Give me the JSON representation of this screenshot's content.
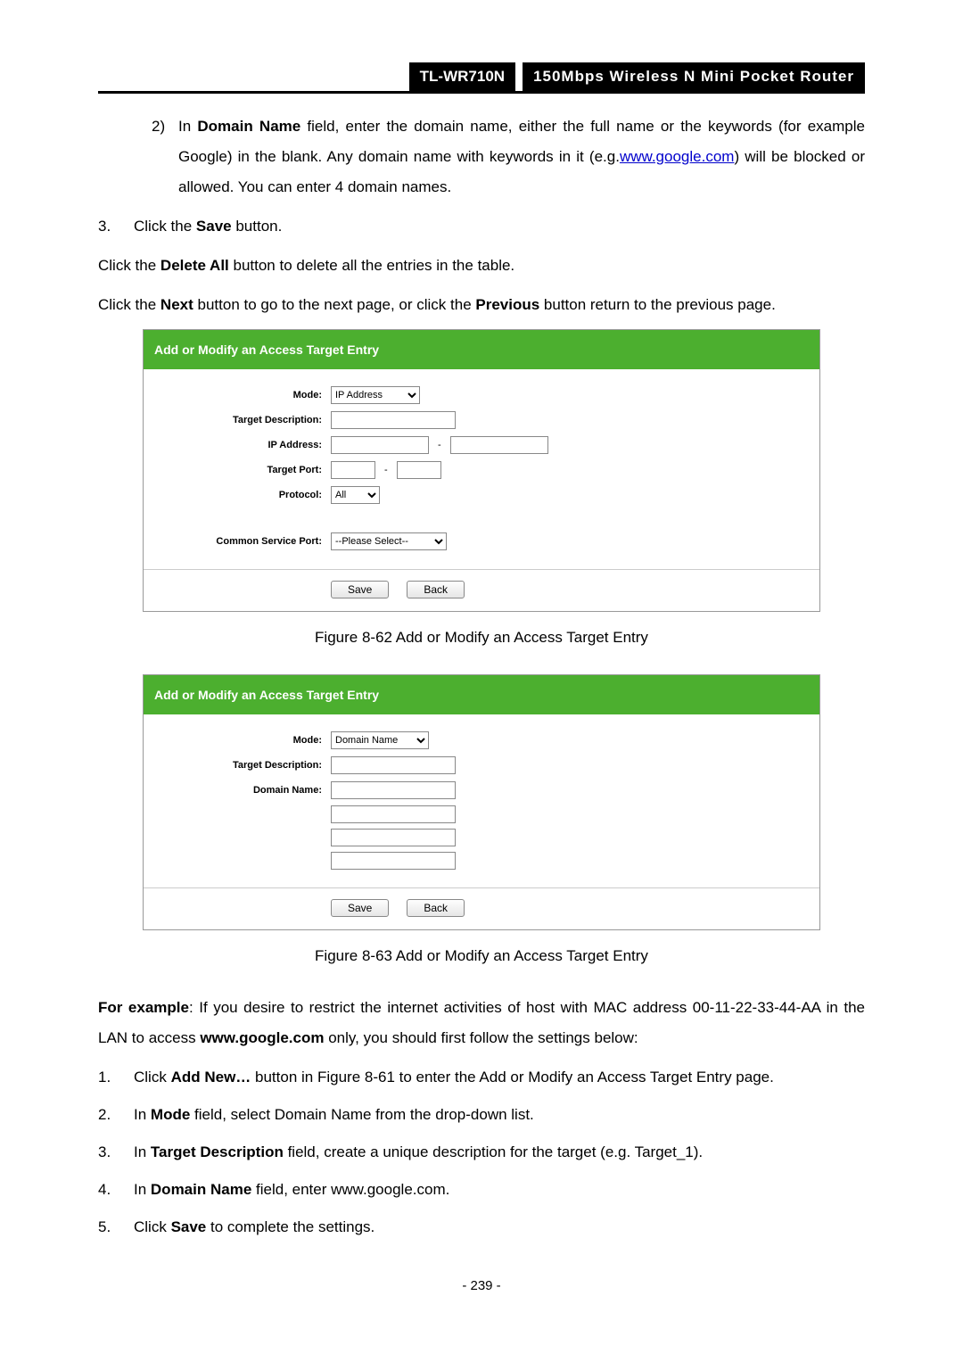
{
  "header": {
    "model": "TL-WR710N",
    "desc": "150Mbps Wireless N Mini Pocket Router"
  },
  "intro": {
    "item2_marker": "2)",
    "item2_prefix": "In ",
    "item2_bold": "Domain Name",
    "item2_rest_a": " field, enter the domain name, either the full name or the keywords (for example Google) in the blank. Any domain name with keywords in it (e.g.",
    "item2_link": "www.google.com",
    "item2_rest_b": ") will be blocked or allowed. You can enter 4 domain names.",
    "item3_marker": "3.",
    "item3_text_a": "Click the ",
    "item3_bold": "Save",
    "item3_text_b": " button.",
    "para_delete_a": "Click the ",
    "para_delete_bold": "Delete All",
    "para_delete_b": " button to delete all the entries in the table.",
    "para_nav_a": "Click the ",
    "para_nav_bold1": "Next",
    "para_nav_b": " button to go to the next page, or click the ",
    "para_nav_bold2": "Previous",
    "para_nav_c": " button return to the previous page."
  },
  "panel1": {
    "title": "Add or Modify an Access Target Entry",
    "labels": {
      "mode": "Mode:",
      "target_desc": "Target Description:",
      "ip": "IP Address:",
      "port": "Target Port:",
      "protocol": "Protocol:",
      "common": "Common Service Port:"
    },
    "values": {
      "mode": "IP Address",
      "protocol": "All",
      "common": "--Please Select--"
    },
    "buttons": {
      "save": "Save",
      "back": "Back"
    }
  },
  "caption1": "Figure 8-62    Add or Modify an Access Target Entry",
  "panel2": {
    "title": "Add or Modify an Access Target Entry",
    "labels": {
      "mode": "Mode:",
      "target_desc": "Target Description:",
      "domain": "Domain Name:"
    },
    "values": {
      "mode": "Domain Name"
    },
    "buttons": {
      "save": "Save",
      "back": "Back"
    }
  },
  "caption2": "Figure 8-63    Add or Modify an Access Target Entry",
  "example": {
    "lead_bold": "For example",
    "lead_a": ": If you desire to restrict the internet activities of host with MAC address 00-11-22-33-44-AA in the LAN to access ",
    "lead_bold2": "www.google.com",
    "lead_b": " only, you should first follow the settings below:",
    "steps": {
      "s1_num": "1.",
      "s1_a": "Click ",
      "s1_bold": "Add New…",
      "s1_b": " button in Figure 8-61 to enter the Add or Modify an Access Target Entry page.",
      "s2_num": "2.",
      "s2_a": "In ",
      "s2_bold": "Mode",
      "s2_b": " field, select Domain Name from the drop-down list.",
      "s3_num": "3.",
      "s3_a": "In ",
      "s3_bold": "Target Description",
      "s3_b": " field, create a unique description for the target (e.g. Target_1).",
      "s4_num": "4.",
      "s4_a": "In ",
      "s4_bold": "Domain Name",
      "s4_b": " field, enter www.google.com.",
      "s5_num": "5.",
      "s5_a": "Click ",
      "s5_bold": "Save",
      "s5_b": " to complete the settings."
    }
  },
  "page_number": "- 239 -"
}
